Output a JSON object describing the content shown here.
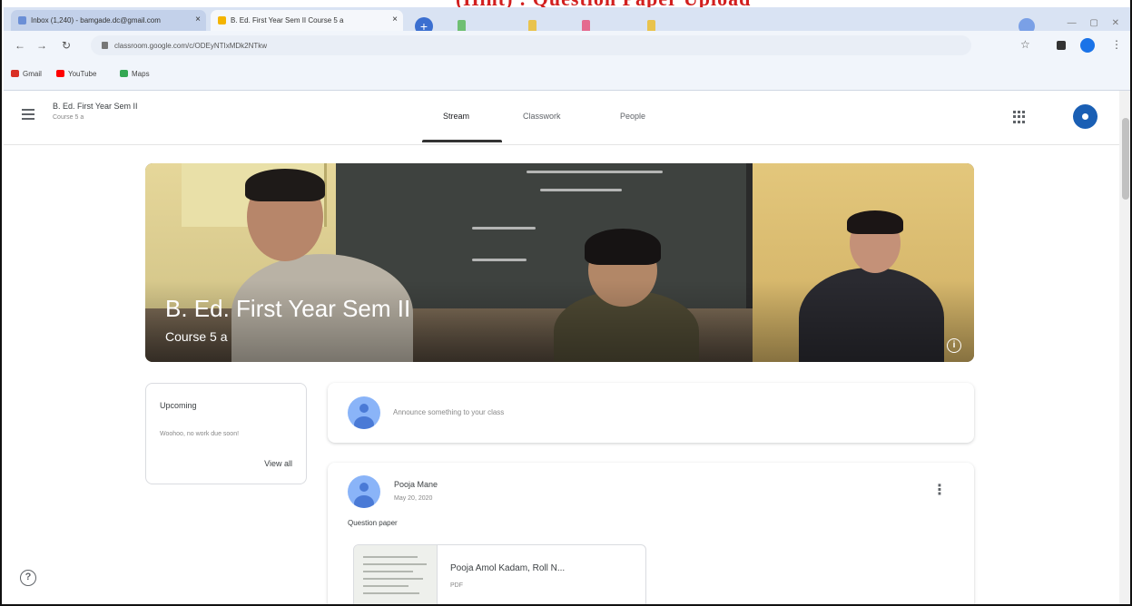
{
  "watermark": "(Hint) : Question Paper Upload",
  "browser": {
    "tabs": [
      {
        "label": "Inbox (1,240) - bamgade.dc@gmail.com",
        "icon": "mail-icon"
      },
      {
        "label": "B. Ed. First Year Sem II Course 5 a",
        "icon": "classroom-icon"
      }
    ],
    "url": "classroom.google.com/c/ODEyNTIxMDk2NTkw",
    "bookmarks": [
      {
        "label": "Gmail",
        "icon": "gmail-icon",
        "color": "#d93025"
      },
      {
        "label": "YouTube",
        "icon": "youtube-icon",
        "color": "#ff0000"
      },
      {
        "label": "Maps",
        "icon": "maps-icon",
        "color": "#34a853"
      }
    ]
  },
  "classroom": {
    "course_title": "B. Ed. First Year Sem II",
    "course_section": "Course 5 a",
    "nav": {
      "stream": "Stream",
      "classwork": "Classwork",
      "people": "People"
    },
    "banner": {
      "title": "B. Ed. First Year Sem II",
      "subtitle": "Course 5 a"
    },
    "upcoming": {
      "title": "Upcoming",
      "body": "Woohoo, no work due soon!",
      "link": "View all"
    },
    "announce_placeholder": "Announce something to your class",
    "post": {
      "author": "Pooja Mane",
      "date": "May 20, 2020",
      "text": "Question paper",
      "attachment": {
        "name": "Pooja Amol Kadam, Roll N...",
        "type": "PDF"
      }
    }
  },
  "colors": {
    "accent": "#1a73e8",
    "banner_text": "#ffffff"
  }
}
